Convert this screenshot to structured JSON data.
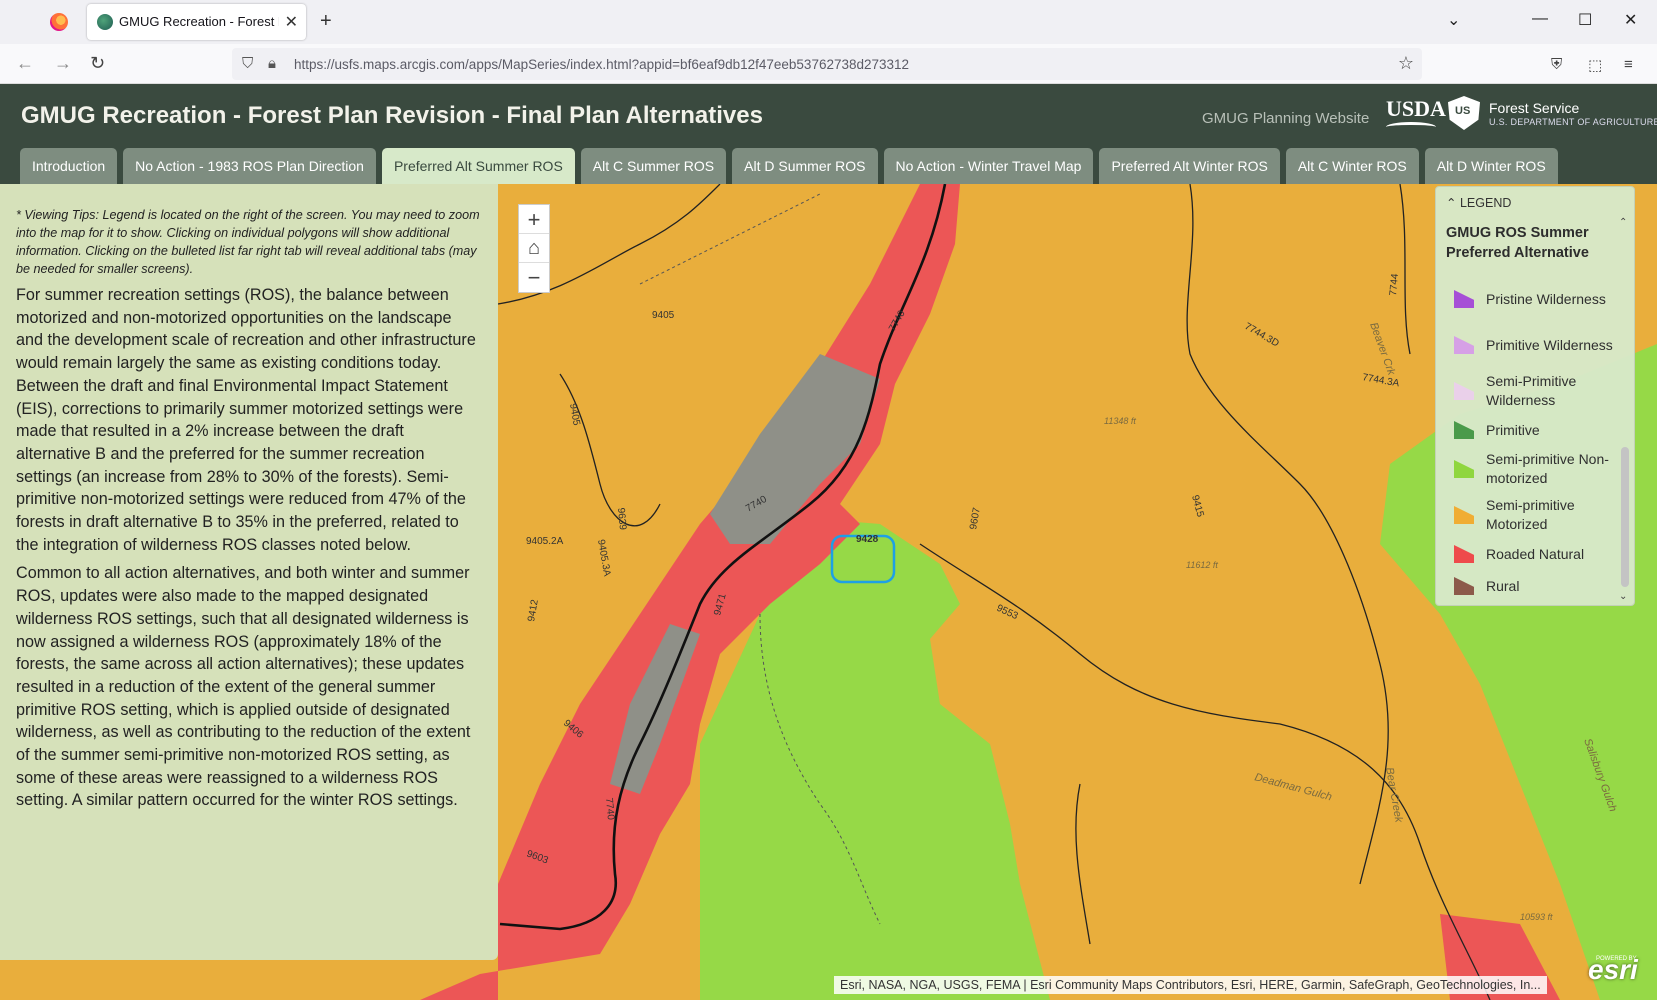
{
  "browser": {
    "tab_title": "GMUG Recreation - Forest Plan",
    "url": "https://usfs.maps.arcgis.com/apps/MapSeries/index.html?appid=bf6eaf9db12f47eeb53762738d273312"
  },
  "header": {
    "title": "GMUG Recreation - Forest Plan Revision - Final Plan Alternatives",
    "planning_link": "GMUG Planning Website",
    "usda": "USDA",
    "fs_name": "Forest Service",
    "fs_sub": "U.S. DEPARTMENT OF AGRICULTURE"
  },
  "tabs": [
    {
      "label": "Introduction"
    },
    {
      "label": "No Action - 1983 ROS Plan Direction"
    },
    {
      "label": "Preferred Alt Summer ROS"
    },
    {
      "label": "Alt C Summer ROS"
    },
    {
      "label": "Alt D Summer ROS"
    },
    {
      "label": "No Action - Winter Travel Map"
    },
    {
      "label": "Preferred Alt Winter ROS"
    },
    {
      "label": "Alt C Winter ROS"
    },
    {
      "label": "Alt D Winter ROS"
    }
  ],
  "active_tab": 2,
  "panel": {
    "tips": "* Viewing Tips: Legend is located on the right of the screen. You may need to zoom into the map for it to show. Clicking on individual polygons will show additional information. Clicking on the bulleted list far right tab will reveal additional tabs (may be needed for smaller screens).",
    "para1": "For summer recreation settings (ROS), the balance between motorized and non-motorized opportunities on the landscape and the development scale of recreation and other infrastructure would remain largely the same as existing conditions today. Between the draft and final Environmental Impact Statement (EIS), corrections to primarily summer motorized settings were made that resulted in a 2% increase between the draft alternative B and the preferred for the summer recreation settings (an increase from 28% to 30% of the forests). Semi-primitive non-motorized settings were reduced from 47% of the forests in draft alternative B to 35% in the preferred, related to the integration of wilderness ROS classes noted below.",
    "para2": "Common to all action alternatives, and both winter and summer ROS, updates were also made to the mapped designated wilderness ROS settings, such that all designated wilderness is now assigned a wilderness ROS (approximately 18% of the forests, the same across all action alternatives); these updates resulted in a reduction of the extent of the general summer primitive ROS setting, which is applied outside of designated wilderness, as well as contributing to the reduction of the extent of the summer semi-primitive non-motorized ROS setting, as some of these areas were reassigned to a wilderness ROS setting. A similar pattern occurred for the winter ROS settings."
  },
  "legend": {
    "header": "LEGEND",
    "title": "GMUG ROS Summer Preferred Alternative",
    "items": [
      {
        "label": "Pristine Wilderness",
        "color": "#a64fd6"
      },
      {
        "label": "Primitive Wilderness",
        "color": "#d6a0e6"
      },
      {
        "label": "Semi-Primitive Wilderness",
        "color": "#ead0ea"
      },
      {
        "label": "Primitive",
        "color": "#4a9a4a"
      },
      {
        "label": "Semi-primitive Non-motorized",
        "color": "#8fd63e"
      },
      {
        "label": "Semi-primitive Motorized",
        "color": "#f0ad33"
      },
      {
        "label": "Roaded Natural",
        "color": "#ee4b4b"
      },
      {
        "label": "Rural",
        "color": "#8c5a4a"
      }
    ]
  },
  "map": {
    "colors": {
      "motorized": "#e9ae3c",
      "non_motorized": "#96d947",
      "roaded": "#ec5656",
      "rural_gray": "#8f9088",
      "selection": "#1ea0e6"
    },
    "road_labels": [
      "9405",
      "9405",
      "9405.2A",
      "9405.3A",
      "9639",
      "7740",
      "7740",
      "7740",
      "9471",
      "9412",
      "9406",
      "9603",
      "9607",
      "9553",
      "9415",
      "7744",
      "7744.3D",
      "7744.3A",
      "9428"
    ],
    "feature_labels": [
      "Deadman Gulch",
      "Bear Creek",
      "Salisbury Gulch",
      "Beaver Crk"
    ],
    "elevations": [
      "11348 ft",
      "11612 ft",
      "10593 ft"
    ],
    "attribution": "Esri, NASA, NGA, USGS, FEMA | Esri Community Maps Contributors, Esri, HERE, Garmin, SafeGraph, GeoTechnologies, In...",
    "esri_logo": "esri",
    "esri_powered": "POWERED BY"
  },
  "icons": {
    "zoom_in": "+",
    "home": "⌂",
    "zoom_out": "−",
    "legend_collapse": "⌃"
  }
}
